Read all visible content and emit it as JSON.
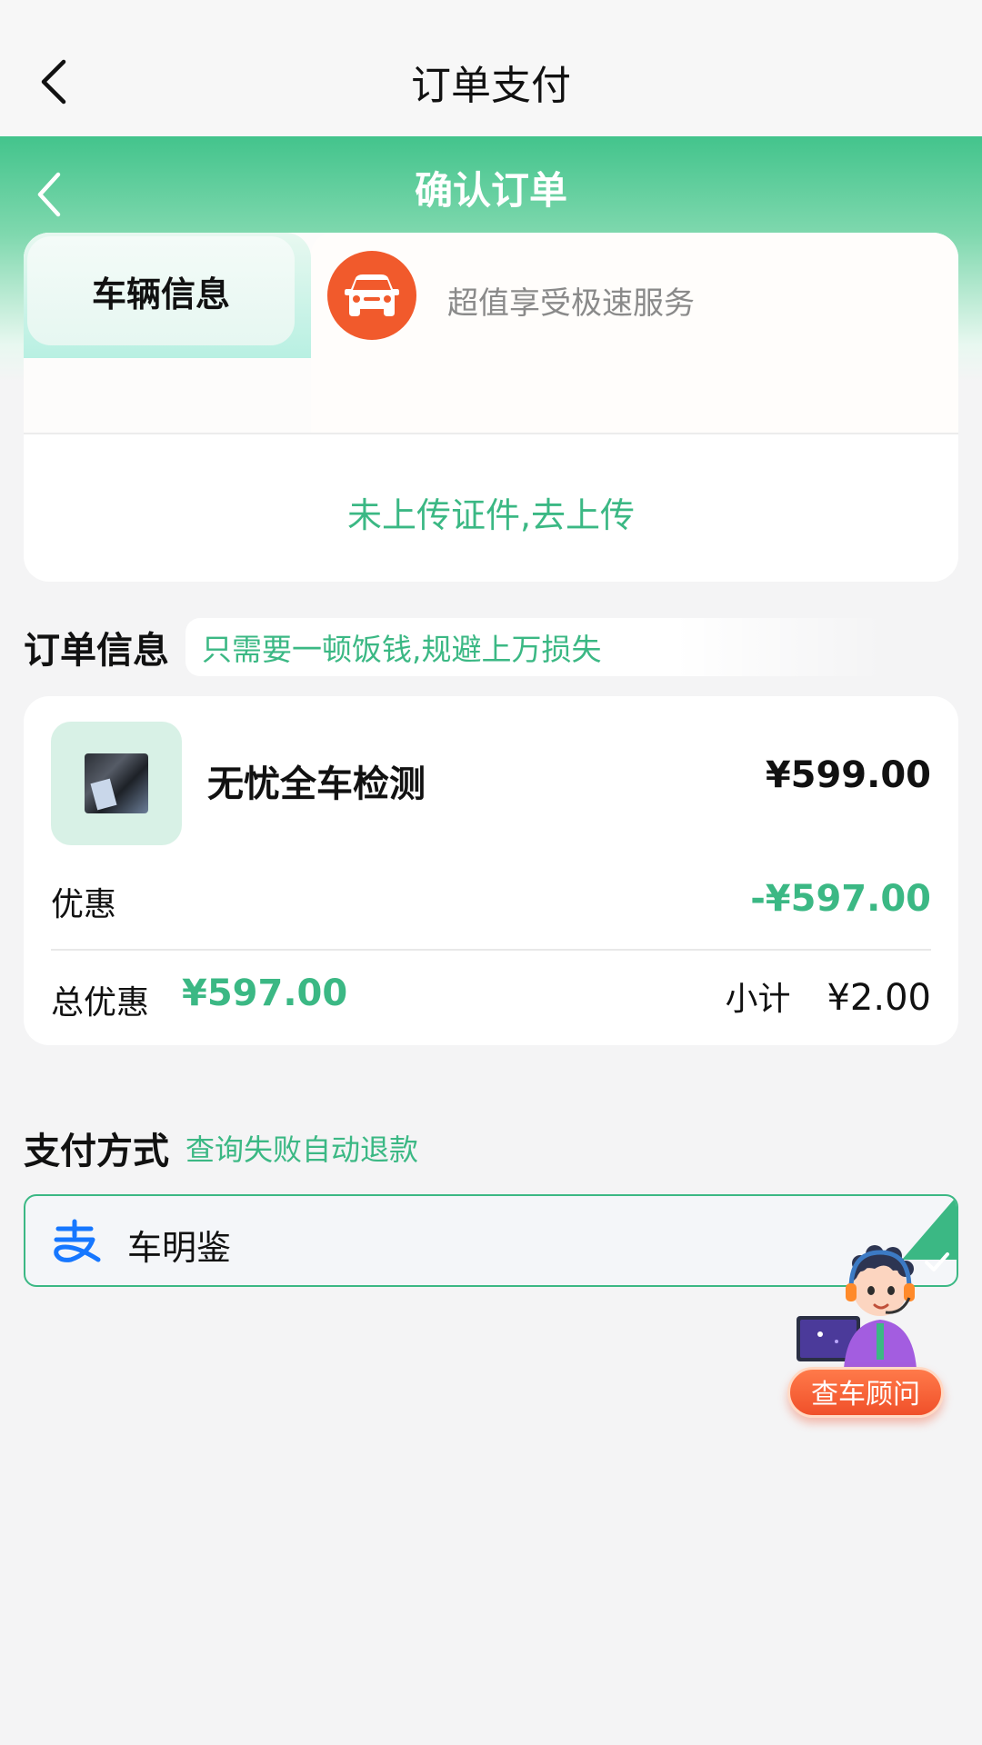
{
  "nav": {
    "title": "订单支付"
  },
  "header": {
    "title": "确认订单"
  },
  "vehicle": {
    "tab_active": "车辆信息",
    "promo": "超值享受极速服务",
    "upload_link": "未上传证件,去上传"
  },
  "order": {
    "heading": "订单信息",
    "tip": "只需要一顿饭钱,规避上万损失",
    "product_name": "无忧全车检测",
    "price": "¥599.00",
    "discount_label": "优惠",
    "discount_value": "-¥597.00",
    "total_discount_label": "总优惠",
    "total_discount_value": "¥597.00",
    "subtotal_label": "小计",
    "subtotal_value": "¥2.00"
  },
  "payment": {
    "heading": "支付方式",
    "tip": "查询失败自动退款",
    "method": "车明鉴",
    "selected": true
  },
  "advisor": {
    "label": "查车顾问"
  },
  "colors": {
    "brand_green": "#3bb884",
    "accent_orange": "#f15a2c"
  }
}
